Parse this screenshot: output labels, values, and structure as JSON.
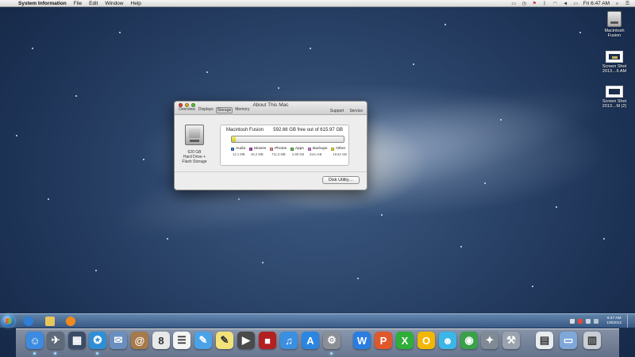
{
  "menubar": {
    "apple_glyph": "",
    "app_name": "System Information",
    "menus": [
      "File",
      "Edit",
      "Window",
      "Help"
    ],
    "clock": "Fri 6:47 AM"
  },
  "desktop_icons": [
    {
      "label": "Macintosh Fusion",
      "icon": "hard-drive-icon"
    },
    {
      "label": "Screen Shot 2013…6 AM",
      "icon": "screenshot-icon"
    },
    {
      "label": "Screen Shot 2013…M (2)",
      "icon": "screenshot-icon"
    }
  ],
  "window": {
    "title": "About This Mac",
    "tabs": [
      {
        "label": "Overview",
        "selected": false
      },
      {
        "label": "Displays",
        "selected": false
      },
      {
        "label": "Storage",
        "selected": true
      },
      {
        "label": "Memory",
        "selected": false
      }
    ],
    "links": [
      "Support",
      "Service"
    ],
    "drive": {
      "capacity": "620 GB",
      "type_line1": "Hard Drive +",
      "type_line2": "Flash Storage"
    },
    "volume": {
      "name": "Macintosh Fusion",
      "free_text": "592.66 GB free out of 615.97 GB",
      "used_fraction": 0.038
    },
    "legend": [
      {
        "label": "Audio",
        "size": "12.1 MB",
        "color": "#4a7fd6"
      },
      {
        "label": "Movies",
        "size": "45.2 MB",
        "color": "#b64ab8"
      },
      {
        "label": "Photos",
        "size": "711.5 MB",
        "color": "#e48f8f"
      },
      {
        "label": "Apps",
        "size": "2.88 GB",
        "color": "#63c24a"
      },
      {
        "label": "Backups",
        "size": "Zero KB",
        "color": "#d57ad6"
      },
      {
        "label": "Other",
        "size": "19.64 GB",
        "color": "#e7df3b"
      }
    ],
    "disk_utility_button": "Disk Utility…"
  },
  "taskbar": {
    "time": "6:47 AM",
    "date": "1/8/2012",
    "colors": {
      "ie": "#2f7ed8",
      "explorer": "#e9c65a",
      "media": "#f08a1c"
    }
  },
  "dock": {
    "apps": [
      {
        "name": "finder",
        "glyph": "☺",
        "color": "#3d8be0"
      },
      {
        "name": "launchpad",
        "glyph": "✈",
        "color": "#5f6b7a"
      },
      {
        "name": "mission-control",
        "glyph": "▦",
        "color": "#3b4c66"
      },
      {
        "name": "safari",
        "glyph": "✪",
        "color": "#2f8fd6"
      },
      {
        "name": "mail",
        "glyph": "✉",
        "color": "#6a8fbf"
      },
      {
        "name": "contacts",
        "glyph": "@",
        "color": "#a67a4b"
      },
      {
        "name": "calendar",
        "glyph": "8",
        "color": "#e8e8e8"
      },
      {
        "name": "reminders",
        "glyph": "☰",
        "color": "#f4f4f4"
      },
      {
        "name": "messages",
        "glyph": "✎",
        "color": "#4aa3e8"
      },
      {
        "name": "notes",
        "glyph": "✎",
        "color": "#f3e27a"
      },
      {
        "name": "facetime",
        "glyph": "▶",
        "color": "#4a4a4a"
      },
      {
        "name": "photo-booth",
        "glyph": "■",
        "color": "#b32020"
      },
      {
        "name": "itunes",
        "glyph": "♫",
        "color": "#3a8fe0"
      },
      {
        "name": "app-store",
        "glyph": "A",
        "color": "#2a86e0"
      },
      {
        "name": "system-preferences",
        "glyph": "⚙",
        "color": "#8a8f96"
      },
      {
        "name": "word",
        "glyph": "W",
        "color": "#2a7de1"
      },
      {
        "name": "powerpoint",
        "glyph": "P",
        "color": "#e0572a"
      },
      {
        "name": "excel",
        "glyph": "X",
        "color": "#2fae3a"
      },
      {
        "name": "outlook",
        "glyph": "O",
        "color": "#f2b705"
      },
      {
        "name": "messenger",
        "glyph": "☻",
        "color": "#3bb6e8"
      },
      {
        "name": "remote-desktop",
        "glyph": "◉",
        "color": "#3aa04a"
      },
      {
        "name": "satellite",
        "glyph": "✦",
        "color": "#7f8a95"
      },
      {
        "name": "utilities",
        "glyph": "⚒",
        "color": "#9aa3ad"
      },
      {
        "name": "documents-stack",
        "glyph": "▤",
        "color": "#e8ecef"
      },
      {
        "name": "downloads-folder",
        "glyph": "▭",
        "color": "#7fa8d8"
      },
      {
        "name": "trash",
        "glyph": "▥",
        "color": "#c9ced4"
      }
    ]
  }
}
